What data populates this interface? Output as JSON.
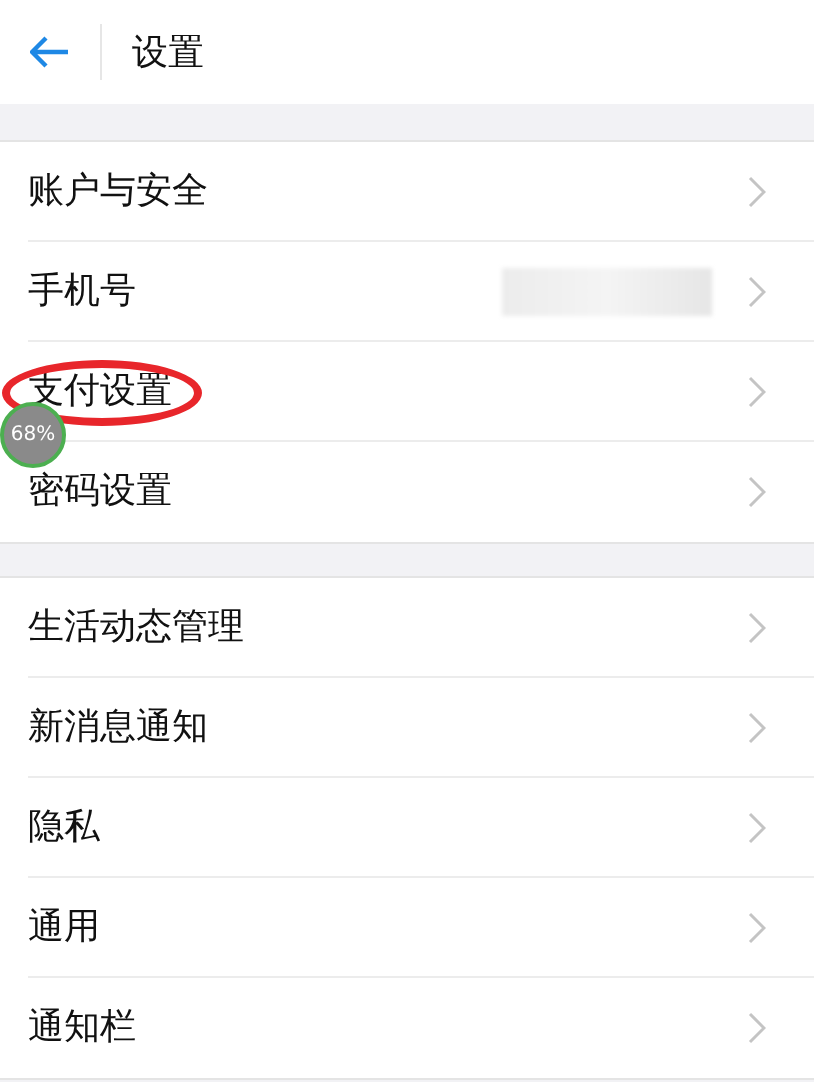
{
  "header": {
    "title": "设置"
  },
  "groups": [
    {
      "items": [
        {
          "label": "账户与安全",
          "redacted": false,
          "circled": false
        },
        {
          "label": "手机号",
          "redacted": true,
          "circled": false
        },
        {
          "label": "支付设置",
          "redacted": false,
          "circled": true
        },
        {
          "label": "密码设置",
          "redacted": false,
          "circled": false
        }
      ]
    },
    {
      "items": [
        {
          "label": "生活动态管理",
          "redacted": false,
          "circled": false
        },
        {
          "label": "新消息通知",
          "redacted": false,
          "circled": false
        },
        {
          "label": "隐私",
          "redacted": false,
          "circled": false
        },
        {
          "label": "通用",
          "redacted": false,
          "circled": false
        },
        {
          "label": "通知栏",
          "redacted": false,
          "circled": false
        }
      ]
    }
  ],
  "floating_badge": {
    "text": "68%"
  }
}
